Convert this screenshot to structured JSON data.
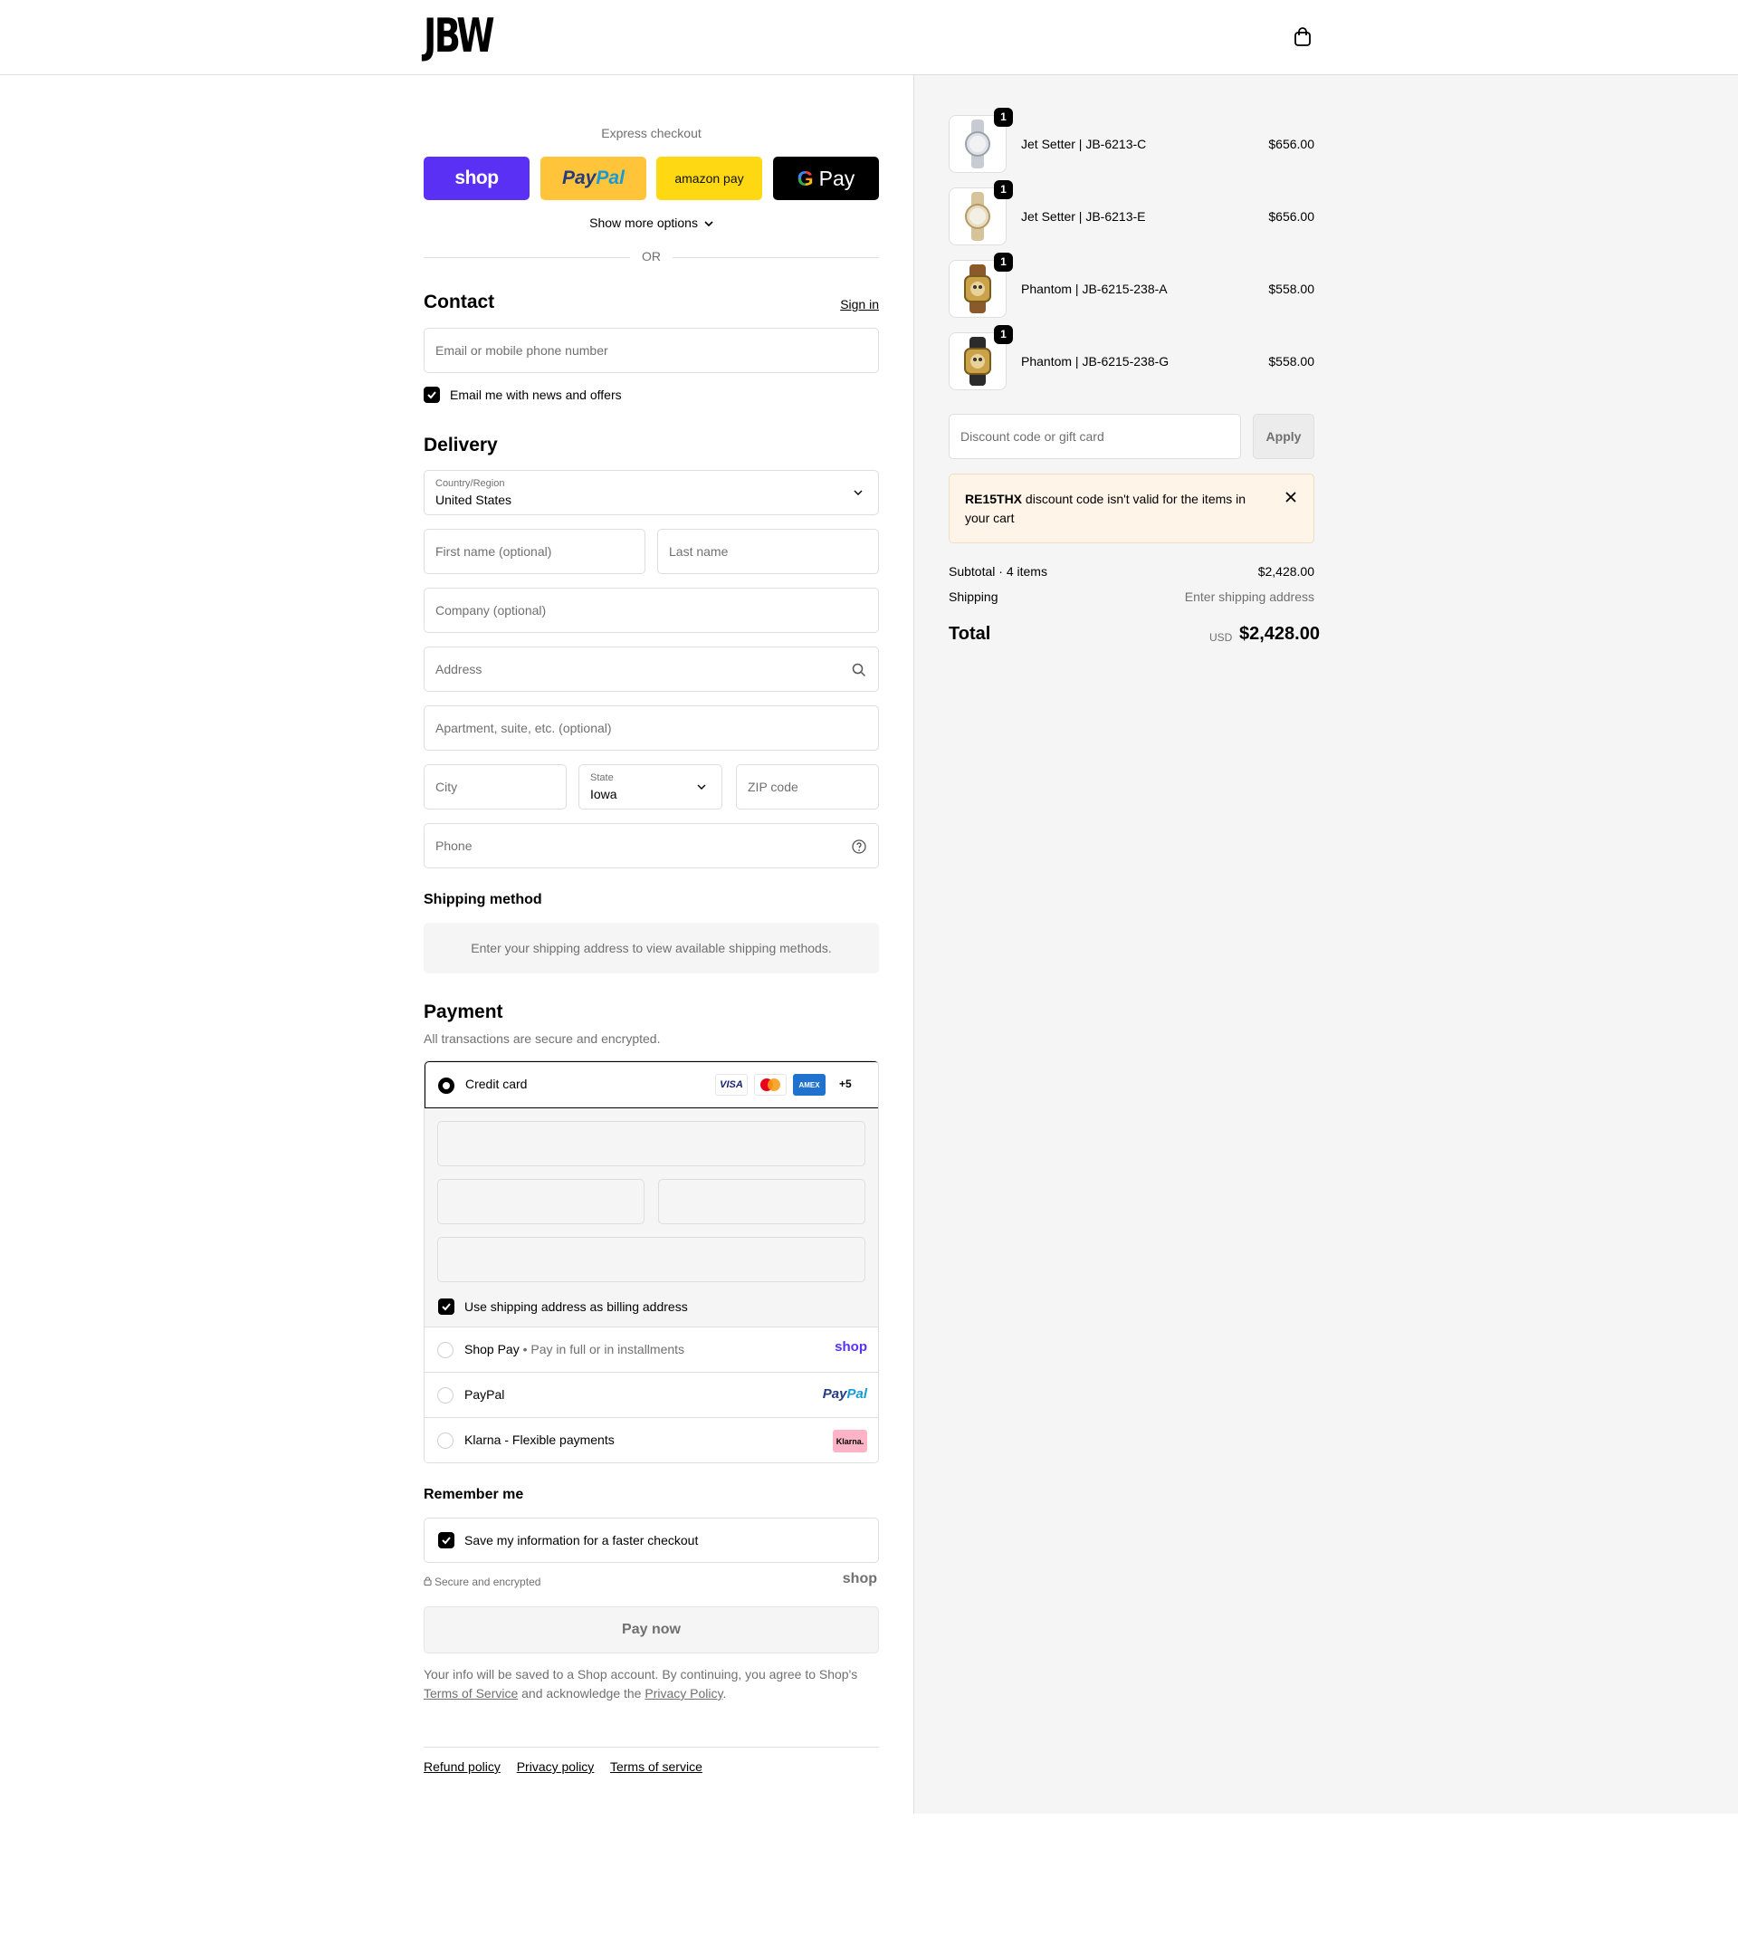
{
  "header": {
    "logo": "JBW",
    "cart_icon": "shopping-bag-icon"
  },
  "express": {
    "title": "Express checkout",
    "buttons": {
      "shop": "shop",
      "paypal_a": "Pay",
      "paypal_b": "Pal",
      "amazon": "amazon pay",
      "gpay_g": "G",
      "gpay": "Pay"
    },
    "more_options": "Show more options",
    "or": "OR"
  },
  "contact": {
    "title": "Contact",
    "sign_in": "Sign in",
    "email_placeholder": "Email or mobile phone number",
    "newsletter_label": "Email me with news and offers",
    "newsletter_checked": true
  },
  "delivery": {
    "title": "Delivery",
    "country_label": "Country/Region",
    "country_value": "United States",
    "first_name_placeholder": "First name (optional)",
    "last_name_placeholder": "Last name",
    "company_placeholder": "Company (optional)",
    "address_placeholder": "Address",
    "apartment_placeholder": "Apartment, suite, etc. (optional)",
    "city_placeholder": "City",
    "state_label": "State",
    "state_value": "Iowa",
    "zip_placeholder": "ZIP code",
    "phone_placeholder": "Phone"
  },
  "shipping_method": {
    "title": "Shipping method",
    "info": "Enter your shipping address to view available shipping methods."
  },
  "payment": {
    "title": "Payment",
    "subtitle": "All transactions are secure and encrypted.",
    "credit_card_label": "Credit card",
    "card_logos": {
      "visa": "VISA",
      "amex": "AMEX"
    },
    "more_cards": "+5",
    "billing_same_label": "Use shipping address as billing address",
    "billing_same_checked": true,
    "methods": {
      "shop_pay": {
        "label": "Shop Pay",
        "sub": "Pay in full or in installments",
        "brand": "shop"
      },
      "paypal": {
        "label": "PayPal",
        "brand_a": "Pay",
        "brand_b": "Pal"
      },
      "klarna": {
        "label": "Klarna - Flexible payments",
        "brand": "Klarna."
      }
    }
  },
  "remember": {
    "title": "Remember me",
    "save_label": "Save my information for a faster checkout",
    "save_checked": true,
    "secure_text": "Secure and encrypted",
    "secure_brand": "shop"
  },
  "pay_now": "Pay now",
  "legal": {
    "text_a": "Your info will be saved to a Shop account. By continuing, you agree to Shop's ",
    "terms": "Terms of Service",
    "text_b": " and acknowledge the ",
    "privacy": "Privacy Policy",
    "text_c": "."
  },
  "footer": {
    "refund": "Refund policy",
    "privacy": "Privacy policy",
    "terms": "Terms of service"
  },
  "cart": {
    "items": [
      {
        "name": "Jet Setter | JB-6213-C",
        "price": "$656.00",
        "qty": "1",
        "watch": "silver"
      },
      {
        "name": "Jet Setter | JB-6213-E",
        "price": "$656.00",
        "qty": "1",
        "watch": "two-tone"
      },
      {
        "name": "Phantom | JB-6215-238-A",
        "price": "$558.00",
        "qty": "1",
        "watch": "gold-skull"
      },
      {
        "name": "Phantom | JB-6215-238-G",
        "price": "$558.00",
        "qty": "1",
        "watch": "gold-skull-black"
      }
    ],
    "discount_placeholder": "Discount code or gift card",
    "apply_label": "Apply",
    "alert_code": "RE15THX",
    "alert_text": " discount code isn't valid for the items in your cart",
    "subtotal_label": "Subtotal · 4 items",
    "subtotal_value": "$2,428.00",
    "shipping_label": "Shipping",
    "shipping_value": "Enter shipping address",
    "total_label": "Total",
    "total_currency": "USD",
    "total_value": "$2,428.00"
  },
  "colors": {
    "shop_purple": "#5a31f4",
    "paypal_yellow": "#ffc439",
    "amazon_yellow": "#ffd814",
    "panel_gray": "#f5f5f5",
    "alert_bg": "#fff4e8"
  }
}
